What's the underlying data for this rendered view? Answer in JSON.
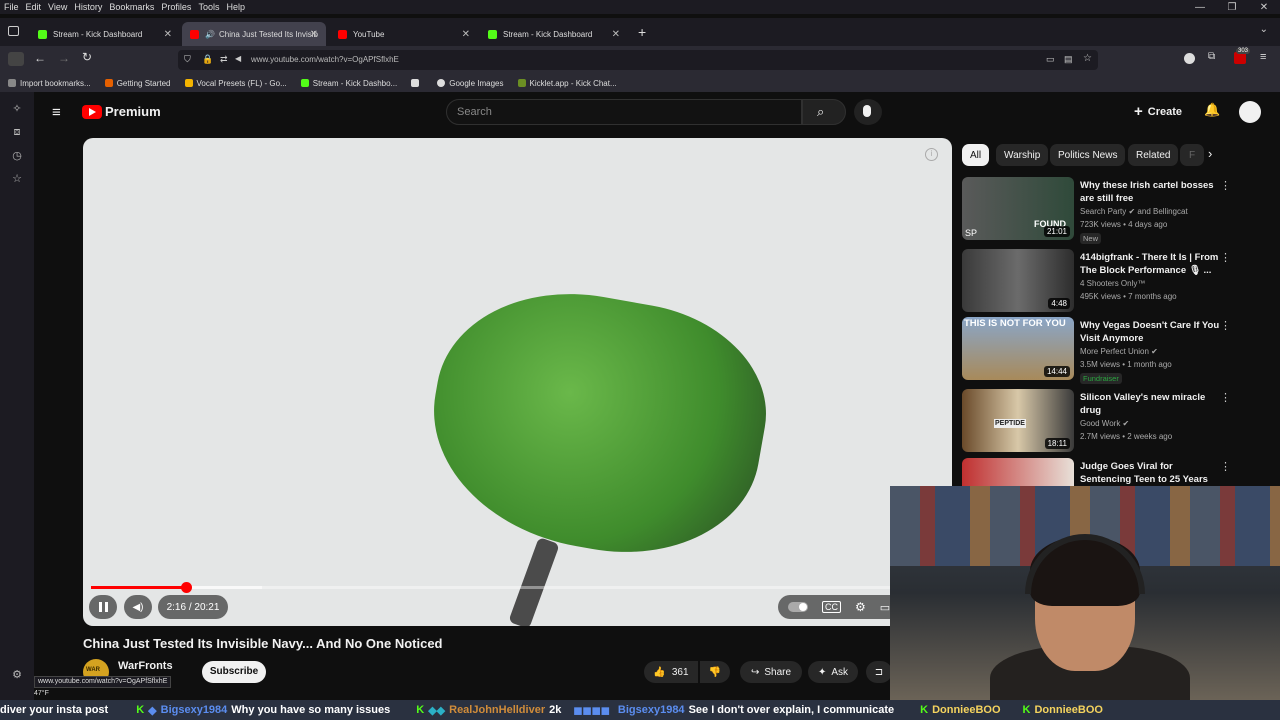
{
  "menu": [
    "File",
    "Edit",
    "View",
    "History",
    "Bookmarks",
    "Profiles",
    "Tools",
    "Help"
  ],
  "tabs": [
    {
      "label": "Stream - Kick Dashboard",
      "active": false,
      "icon": "kick-icon"
    },
    {
      "label": "China Just Tested Its Invisib",
      "active": true,
      "icon": "youtube-icon"
    },
    {
      "label": "YouTube",
      "active": false,
      "icon": "youtube-icon"
    },
    {
      "label": "Stream - Kick Dashboard",
      "active": false,
      "icon": "kick-icon"
    }
  ],
  "url": "www.youtube.com/watch?v=OgAPfSflxhE",
  "extension_badge": "303",
  "bookmarks": [
    "Import bookmarks...",
    "Getting Started",
    "Vocal Presets (FL) - Go...",
    "Stream - Kick Dashbo...",
    "Google Images",
    "Kicklet.app - Kick Chat..."
  ],
  "yt": {
    "logo": "Premium",
    "search_placeholder": "Search",
    "create": "Create"
  },
  "player": {
    "current": "2:16",
    "total": "20:21",
    "time_label": "2:16 / 20:21",
    "played_fraction": 0.111,
    "buffered_fraction": 0.2
  },
  "video": {
    "title": "China Just Tested Its Invisible Navy... And No One Noticed",
    "channel": "WarFronts",
    "subscribe": "Subscribe",
    "likes": "361",
    "share": "Share",
    "ask": "Ask"
  },
  "chips": [
    "All",
    "Warship",
    "Politics News",
    "Related",
    "F"
  ],
  "recommendations": [
    {
      "title": "Why these Irish cartel bosses are still free",
      "channel": "Search Party",
      "channel_extra": "and Bellingcat",
      "meta": "723K views • 4 days ago",
      "badge": "New",
      "duration": "21:01",
      "thumb_text": "FOUND",
      "thumb_sub": "SP"
    },
    {
      "title": "414bigfrank - There It Is | From The Block Performance 🎙 ...",
      "channel": "4 Shooters Only™",
      "meta": "495K views • 7 months ago",
      "badge": "",
      "duration": "4:48",
      "thumb_text": "",
      "thumb_sub": ""
    },
    {
      "title": "Why Vegas Doesn't Care If You Visit Anymore",
      "channel": "More Perfect Union",
      "meta": "3.5M views • 1 month ago",
      "badge": "Fundraiser",
      "duration": "14:44",
      "thumb_text": "THIS IS NOT FOR YOU",
      "thumb_sub": ""
    },
    {
      "title": "Silicon Valley's new miracle drug",
      "channel": "Good Work",
      "meta": "2.7M views • 2 weeks ago",
      "badge": "",
      "duration": "18:11",
      "thumb_text": "PEPTIDE",
      "thumb_sub": ""
    },
    {
      "title": "Judge Goes Viral for Sentencing Teen to 25 Years Over ...",
      "channel": "",
      "meta": "",
      "badge": "",
      "duration": "",
      "thumb_text": "",
      "thumb_sub": ""
    }
  ],
  "status_url": "www.youtube.com/watch?v=OgAPfSflxhE",
  "weather": "47°F",
  "ticker": [
    {
      "user": "",
      "msg": "diver your insta post"
    },
    {
      "user": "Bigsexy1984",
      "msg": "Why you have so many issues"
    },
    {
      "user": "RealJohnHelldiver",
      "msg": "2k"
    },
    {
      "user": "Bigsexy1984",
      "msg": "See I don't over explain, I communicate"
    },
    {
      "user": "DonnieeBOO",
      "msg": ""
    },
    {
      "user": "DonnieeBOO",
      "msg": ""
    }
  ],
  "colors": {
    "yt_red": "#ff0000",
    "kick_green": "#53fc18",
    "bg": "#0f0f0f"
  }
}
